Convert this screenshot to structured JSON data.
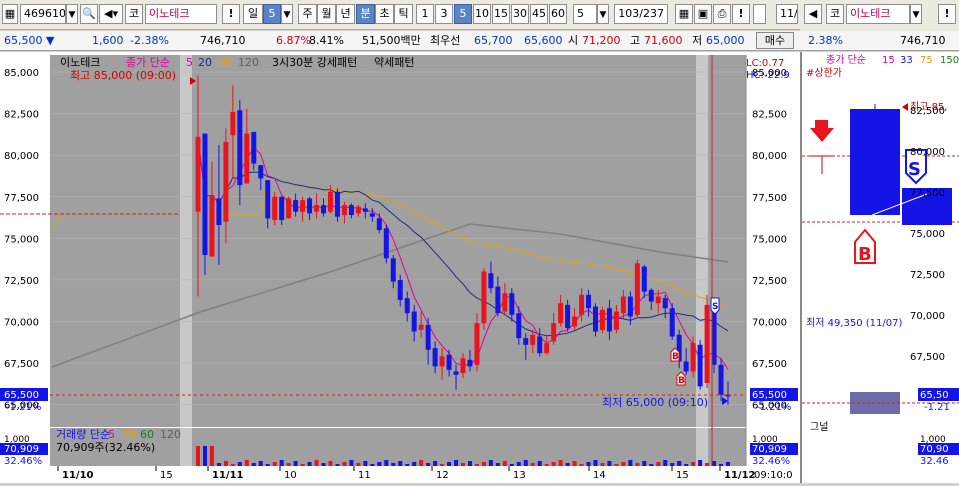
{
  "toolbar": {
    "code": "469610",
    "market": "코",
    "name": "이노테크",
    "period_day": "일",
    "period_num": "5",
    "period_week": "주",
    "period_month": "월",
    "period_year": "년",
    "period_min": "분",
    "period_tick": "초",
    "period_tick2": "틱",
    "intervals": [
      "1",
      "3",
      "5",
      "10",
      "15",
      "30",
      "45",
      "60"
    ],
    "selected_interval": "5",
    "count_select": "5",
    "page_counter": "103/237",
    "right_check": "11/"
  },
  "right_toolbar": {
    "market": "코",
    "name": "이노테크"
  },
  "info": {
    "price": "65,500",
    "arrow": "▼",
    "change": "1,600",
    "change_pct": "-2.38%",
    "volume": "746,710",
    "turnover_pct": "6.87%",
    "other_pct": "8.41%",
    "amount": "51,500백만",
    "best_label": "최우선",
    "ask": "65,700",
    "bid": "65,600",
    "open_label": "시",
    "open": "71,200",
    "high_label": "고",
    "high": "71,600",
    "low_label": "저",
    "low": "65,000",
    "buy_button": "매수"
  },
  "right_info": {
    "change_pct": "2.38%",
    "volume": "746,710"
  },
  "chart": {
    "legend_name": "이노테크",
    "legend_ma_label": "종가 단순",
    "ma_periods": [
      "5",
      "20",
      "60",
      "120"
    ],
    "legend_pattern": "3시30분 강세패턴",
    "legend_weak": "약세패턴",
    "high_label": "최고 85,000 (09:00)",
    "low_label": "최저 65,000 (09:10)",
    "lc_label": "LC:0.77",
    "hc_label": "HC:-22.9",
    "current_price_tag": "65,500",
    "current_pct_tag": "-1.21%",
    "volume_legend": "거래량 단순",
    "volume_value": "70,909주(32.46%)",
    "volume_tag": "70,909",
    "volume_pct_tag": "32.46%",
    "volume_axis_top": "1,000",
    "y_ticks": [
      "85,000",
      "82,500",
      "80,000",
      "77,500",
      "75,000",
      "72,500",
      "70,000",
      "67,500",
      "65,000"
    ],
    "x_ticks": [
      "11/10",
      "15",
      "11/11",
      "10",
      "11",
      "12",
      "13",
      "14",
      "15",
      "11/12"
    ],
    "time_label": "09:10:0",
    "signal_s": "S",
    "signal_b": "B"
  },
  "right_chart": {
    "legend_ma": "종가 단순",
    "ma_periods": [
      "15",
      "33",
      "75",
      "150"
    ],
    "upper_limit": "#상한가",
    "high_label": "최고 85,",
    "low_label": "최저 49,350 (11/07)",
    "signal_label": "그널",
    "y_ticks": [
      "82,500",
      "80,000",
      "77,500",
      "75,000",
      "72,500",
      "70,000",
      "67,500"
    ],
    "price_tag": "65,50",
    "pct_tag": "-1.21",
    "vol_tag": "70,90",
    "vol_pct_tag": "32.46",
    "vol_axis": "1,000"
  },
  "colors": {
    "up": "#e8141e",
    "down": "#1414e6",
    "ma5": "#e000a0",
    "ma20": "#1c2c8c",
    "ma60": "#e8a000",
    "ma120": "#808080",
    "bg_gray": "#a0a0a0"
  },
  "candles": [
    [
      76.6,
      81.1,
      71.5,
      84.8
    ],
    [
      81.3,
      74.0,
      72.8,
      81.3
    ],
    [
      73.9,
      77.6,
      73.9,
      79.6
    ],
    [
      77.4,
      75.8,
      73.4,
      80.6
    ],
    [
      76.0,
      80.8,
      74.7,
      81.6
    ],
    [
      81.2,
      82.6,
      78.6,
      84.2
    ],
    [
      82.7,
      78.2,
      77.0,
      83.3
    ],
    [
      78.3,
      81.3,
      78.3,
      82.8
    ],
    [
      81.4,
      79.5,
      79.1,
      81.4
    ],
    [
      79.4,
      78.6,
      77.9,
      79.4
    ],
    [
      78.5,
      76.2,
      75.6,
      78.5
    ],
    [
      76.1,
      77.5,
      75.8,
      77.8
    ],
    [
      77.5,
      76.1,
      75.8,
      77.5
    ],
    [
      76.2,
      77.4,
      76.2,
      77.5
    ],
    [
      77.3,
      76.6,
      76.3,
      77.7
    ],
    [
      76.6,
      77.3,
      76.0,
      77.5
    ],
    [
      77.4,
      76.5,
      76.1,
      77.5
    ],
    [
      76.6,
      77.0,
      76.2,
      77.7
    ],
    [
      77.0,
      76.5,
      76.3,
      77.4
    ],
    [
      76.6,
      77.8,
      76.5,
      78.2
    ],
    [
      77.8,
      76.3,
      76.0,
      78.0
    ],
    [
      76.4,
      77.0,
      75.9,
      77.2
    ],
    [
      77.0,
      76.4,
      76.2,
      77.1
    ],
    [
      76.5,
      76.9,
      76.3,
      77.0
    ],
    [
      76.8,
      76.6,
      76.2,
      77.1
    ],
    [
      76.5,
      76.3,
      76.0,
      76.8
    ],
    [
      76.2,
      75.5,
      75.3,
      76.5
    ],
    [
      75.6,
      73.8,
      73.5,
      75.8
    ],
    [
      73.8,
      72.4,
      72.0,
      74.0
    ],
    [
      72.5,
      71.3,
      70.9,
      72.8
    ],
    [
      71.4,
      70.5,
      70.0,
      71.8
    ],
    [
      70.6,
      69.4,
      68.8,
      71.0
    ],
    [
      69.5,
      69.8,
      69.0,
      70.6
    ],
    [
      69.8,
      68.3,
      67.4,
      70.2
    ],
    [
      68.4,
      67.3,
      66.9,
      68.8
    ],
    [
      67.3,
      67.9,
      66.5,
      68.4
    ],
    [
      68.0,
      67.1,
      66.7,
      68.3
    ],
    [
      67.0,
      66.8,
      65.9,
      67.4
    ],
    [
      66.9,
      67.8,
      66.6,
      68.1
    ],
    [
      67.7,
      67.3,
      67.0,
      68.3
    ],
    [
      67.4,
      69.9,
      67.0,
      70.5
    ],
    [
      69.9,
      73.0,
      69.5,
      73.2
    ],
    [
      72.9,
      72.0,
      71.7,
      73.6
    ],
    [
      72.1,
      70.5,
      70.3,
      72.7
    ],
    [
      70.6,
      71.7,
      70.4,
      72.3
    ],
    [
      71.7,
      70.4,
      70.0,
      72.0
    ],
    [
      70.5,
      69.0,
      68.6,
      70.9
    ],
    [
      69.0,
      68.6,
      67.7,
      69.3
    ],
    [
      68.6,
      69.2,
      68.1,
      69.5
    ],
    [
      69.1,
      68.1,
      67.9,
      69.6
    ],
    [
      68.1,
      68.7,
      68.0,
      69.2
    ],
    [
      68.8,
      69.9,
      68.6,
      70.5
    ],
    [
      69.9,
      71.1,
      69.7,
      71.6
    ],
    [
      71.0,
      69.6,
      69.4,
      71.3
    ],
    [
      69.7,
      70.3,
      69.5,
      70.8
    ],
    [
      70.4,
      71.6,
      70.0,
      72.0
    ],
    [
      71.6,
      70.8,
      70.3,
      71.9
    ],
    [
      70.9,
      69.4,
      69.1,
      71.1
    ],
    [
      69.5,
      70.7,
      69.3,
      70.9
    ],
    [
      70.8,
      69.4,
      68.9,
      71.3
    ],
    [
      69.5,
      70.6,
      69.3,
      71.0
    ],
    [
      70.5,
      71.5,
      70.2,
      71.9
    ],
    [
      71.5,
      70.3,
      69.8,
      71.8
    ],
    [
      70.4,
      73.5,
      70.2,
      73.7
    ],
    [
      73.3,
      71.8,
      71.4,
      73.4
    ],
    [
      71.9,
      71.2,
      70.7,
      72.0
    ],
    [
      71.1,
      71.5,
      70.5,
      71.9
    ],
    [
      71.4,
      70.8,
      70.2,
      71.6
    ],
    [
      70.8,
      69.1,
      68.9,
      71.1
    ],
    [
      69.2,
      67.6,
      67.2,
      69.5
    ],
    [
      67.6,
      67.0,
      66.8,
      68.4
    ],
    [
      67.0,
      68.7,
      66.6,
      69.1
    ],
    [
      68.6,
      66.1,
      65.9,
      68.9
    ],
    [
      66.3,
      71.0,
      66.0,
      71.6
    ],
    [
      71.0,
      67.4,
      66.9,
      71.0
    ],
    [
      67.4,
      65.6,
      65.2,
      67.8
    ],
    [
      65.6,
      65.5,
      65.0,
      66.4
    ]
  ]
}
